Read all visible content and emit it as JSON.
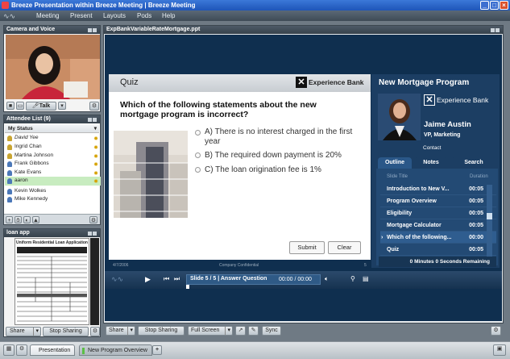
{
  "window": {
    "title": "Breeze Presentation within Breeze Meeting | Breeze Meeting",
    "controls": [
      "_",
      "□",
      "×"
    ]
  },
  "menubar": {
    "items": [
      "Meeting",
      "Present",
      "Layouts",
      "Pods",
      "Help"
    ]
  },
  "camera_pod": {
    "title": "Camera and Voice",
    "talk_label": "Talk"
  },
  "attendee_pod": {
    "title": "Attendee List (9)",
    "status_label": "My Status",
    "attendees": [
      "David Yee",
      "Ingrid Chan",
      "Martina Johnson",
      "Frank Gibbons",
      "Kate Evans",
      "aaron",
      "Kevin Wolkes",
      "Mike Kennedy"
    ]
  },
  "doc_pod": {
    "title": "loan app",
    "doc_title": "Uniform Residential Loan Application",
    "share_label": "Share",
    "stop_label": "Stop Sharing"
  },
  "share_pod": {
    "title": "ExpBankVariableRateMortgage.ppt",
    "share_label": "Share",
    "stop_label": "Stop Sharing",
    "fullscreen_label": "Full Screen",
    "sync_label": "Sync"
  },
  "quiz": {
    "heading": "Quiz",
    "brand": "Experience Bank",
    "question": "Which of the following statements about the new mortgage program is incorrect?",
    "options": [
      "A) There is no interest charged in the first year",
      "B) The required down payment is 20%",
      "C) The loan origination fee is 1%"
    ],
    "submit_label": "Submit",
    "clear_label": "Clear",
    "footer_date": "4/7/2006",
    "footer_center": "Company Confidential",
    "footer_page": "5"
  },
  "presenter": {
    "program_title": "New Mortgage Program",
    "brand": "Experience Bank",
    "name": "Jaime Austin",
    "role": "VP, Marketing",
    "contact_label": "Contact"
  },
  "nav": {
    "tabs": [
      "Outline",
      "Notes",
      "Search"
    ],
    "col_title": "Slide Title",
    "col_duration": "Duration",
    "slides": [
      {
        "title": "Introduction to New V...",
        "duration": "00:05"
      },
      {
        "title": "Program Overview",
        "duration": "00:05"
      },
      {
        "title": "Eligibility",
        "duration": "00:05"
      },
      {
        "title": "Mortgage Calculator",
        "duration": "00:05"
      },
      {
        "title": "Which of the following...",
        "duration": "00:00"
      },
      {
        "title": "Quiz",
        "duration": "00:05"
      }
    ],
    "remaining": "0 Minutes 0 Seconds Remaining"
  },
  "player": {
    "slide_info": "Slide 5 / 5 | Answer Question",
    "time": "00:00 / 00:00"
  },
  "bottom_tabs": [
    "Presentation",
    "New Program Overview"
  ]
}
